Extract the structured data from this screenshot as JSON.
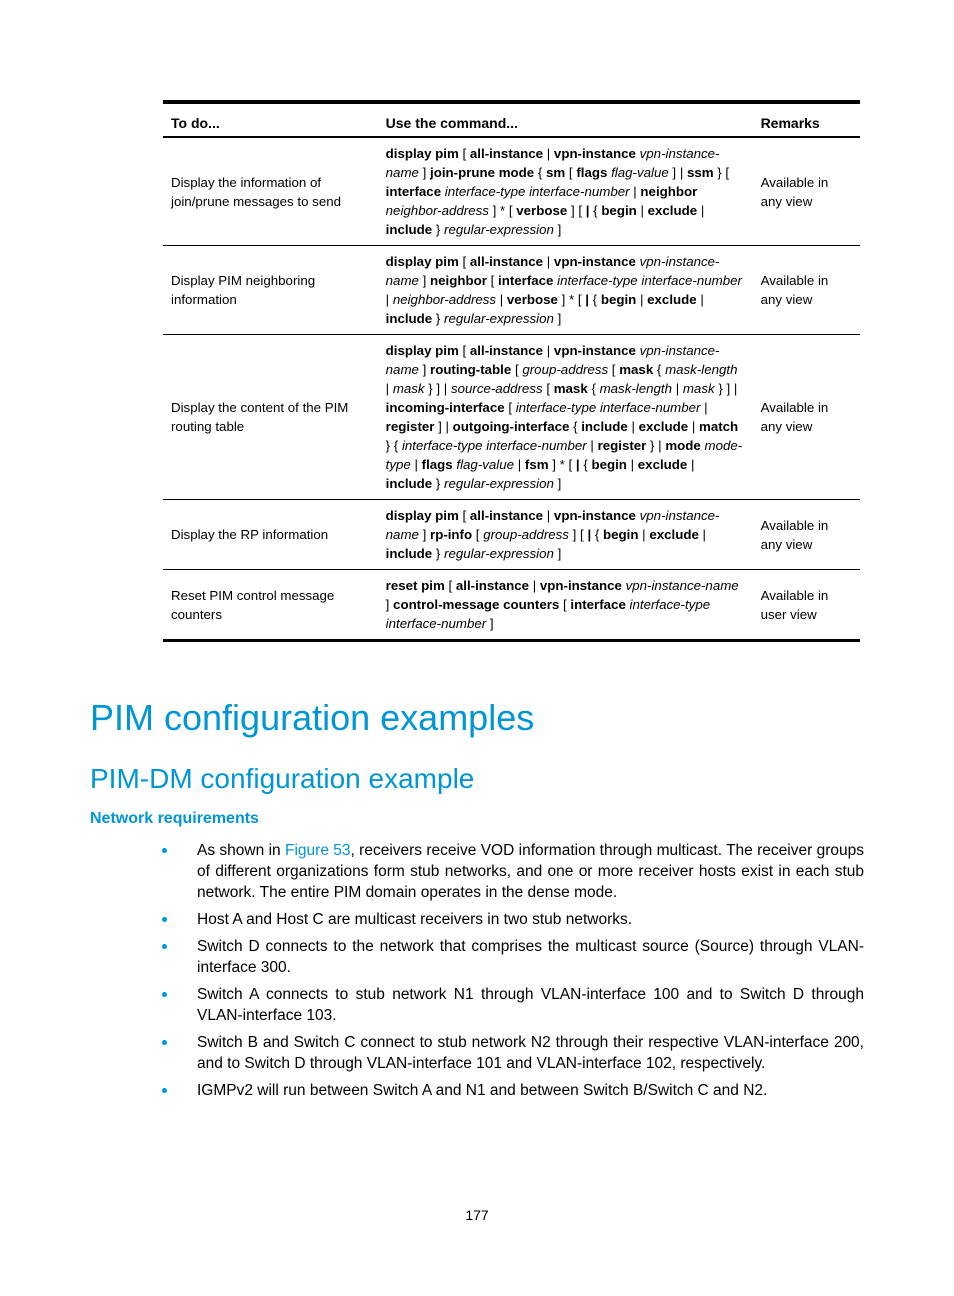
{
  "table": {
    "headers": [
      "To do...",
      "Use the command...",
      "Remarks"
    ],
    "rows": [
      {
        "todo": "Display the information of join/prune messages to send",
        "command_segments": [
          {
            "t": "display pim",
            "s": "b"
          },
          {
            "t": " [ ",
            "s": "n"
          },
          {
            "t": "all-instance",
            "s": "b"
          },
          {
            "t": " | ",
            "s": "n"
          },
          {
            "t": "vpn-instance",
            "s": "b"
          },
          {
            "t": " ",
            "s": "n"
          },
          {
            "t": "vpn-instance-name",
            "s": "i"
          },
          {
            "t": " ] ",
            "s": "n"
          },
          {
            "t": "join-prune mode",
            "s": "b"
          },
          {
            "t": " { ",
            "s": "n"
          },
          {
            "t": "sm",
            "s": "b"
          },
          {
            "t": " [ ",
            "s": "n"
          },
          {
            "t": "flags",
            "s": "b"
          },
          {
            "t": " ",
            "s": "n"
          },
          {
            "t": "flag-value",
            "s": "i"
          },
          {
            "t": " ] | ",
            "s": "n"
          },
          {
            "t": "ssm",
            "s": "b"
          },
          {
            "t": " } [ ",
            "s": "n"
          },
          {
            "t": "interface",
            "s": "b"
          },
          {
            "t": " ",
            "s": "n"
          },
          {
            "t": "interface-type",
            "s": "i"
          },
          {
            "t": " ",
            "s": "n"
          },
          {
            "t": "interface-number",
            "s": "i"
          },
          {
            "t": " | ",
            "s": "n"
          },
          {
            "t": "neighbor",
            "s": "b"
          },
          {
            "t": " ",
            "s": "n"
          },
          {
            "t": "neighbor-address",
            "s": "i"
          },
          {
            "t": " ] * [ ",
            "s": "n"
          },
          {
            "t": "verbose",
            "s": "b"
          },
          {
            "t": " ] [ ",
            "s": "n"
          },
          {
            "t": "|",
            "s": "b"
          },
          {
            "t": " { ",
            "s": "n"
          },
          {
            "t": "begin",
            "s": "b"
          },
          {
            "t": " | ",
            "s": "n"
          },
          {
            "t": "exclude",
            "s": "b"
          },
          {
            "t": " | ",
            "s": "n"
          },
          {
            "t": "include",
            "s": "b"
          },
          {
            "t": " } ",
            "s": "n"
          },
          {
            "t": "regular-expression",
            "s": "i"
          },
          {
            "t": " ]",
            "s": "n"
          }
        ],
        "remarks": "Available in any view"
      },
      {
        "todo": "Display PIM neighboring information",
        "command_segments": [
          {
            "t": "display pim",
            "s": "b"
          },
          {
            "t": " [ ",
            "s": "n"
          },
          {
            "t": "all-instance",
            "s": "b"
          },
          {
            "t": " | ",
            "s": "n"
          },
          {
            "t": "vpn-instance",
            "s": "b"
          },
          {
            "t": " ",
            "s": "n"
          },
          {
            "t": "vpn-instance-name",
            "s": "i"
          },
          {
            "t": " ] ",
            "s": "n"
          },
          {
            "t": "neighbor",
            "s": "b"
          },
          {
            "t": " [ ",
            "s": "n"
          },
          {
            "t": "interface",
            "s": "b"
          },
          {
            "t": " ",
            "s": "n"
          },
          {
            "t": "interface-type",
            "s": "i"
          },
          {
            "t": " ",
            "s": "n"
          },
          {
            "t": "interface-number",
            "s": "i"
          },
          {
            "t": " | ",
            "s": "n"
          },
          {
            "t": "neighbor-address",
            "s": "i"
          },
          {
            "t": " | ",
            "s": "n"
          },
          {
            "t": "verbose",
            "s": "b"
          },
          {
            "t": " ] * [ ",
            "s": "n"
          },
          {
            "t": "|",
            "s": "b"
          },
          {
            "t": " { ",
            "s": "n"
          },
          {
            "t": "begin",
            "s": "b"
          },
          {
            "t": " | ",
            "s": "n"
          },
          {
            "t": "exclude",
            "s": "b"
          },
          {
            "t": " | ",
            "s": "n"
          },
          {
            "t": "include",
            "s": "b"
          },
          {
            "t": " } ",
            "s": "n"
          },
          {
            "t": "regular-expression",
            "s": "i"
          },
          {
            "t": " ]",
            "s": "n"
          }
        ],
        "remarks": "Available in any view"
      },
      {
        "todo": "Display the content of the PIM routing table",
        "command_segments": [
          {
            "t": "display pim",
            "s": "b"
          },
          {
            "t": " [ ",
            "s": "n"
          },
          {
            "t": "all-instance",
            "s": "b"
          },
          {
            "t": " | ",
            "s": "n"
          },
          {
            "t": "vpn-instance",
            "s": "b"
          },
          {
            "t": " ",
            "s": "n"
          },
          {
            "t": "vpn-instance-name",
            "s": "i"
          },
          {
            "t": " ] ",
            "s": "n"
          },
          {
            "t": "routing-table",
            "s": "b"
          },
          {
            "t": " [ ",
            "s": "n"
          },
          {
            "t": "group-address",
            "s": "i"
          },
          {
            "t": " [ ",
            "s": "n"
          },
          {
            "t": "mask",
            "s": "b"
          },
          {
            "t": " ",
            "s": "n"
          },
          {
            "t": "{ ",
            "s": "n"
          },
          {
            "t": "mask-length",
            "s": "i"
          },
          {
            "t": " | ",
            "s": "n"
          },
          {
            "t": "mask",
            "s": "i"
          },
          {
            "t": " } ] | ",
            "s": "n"
          },
          {
            "t": "source-address",
            "s": "i"
          },
          {
            "t": " [ ",
            "s": "n"
          },
          {
            "t": "mask",
            "s": "b"
          },
          {
            "t": " ",
            "s": "n"
          },
          {
            "t": "{ ",
            "s": "n"
          },
          {
            "t": "mask-length",
            "s": "i"
          },
          {
            "t": " | ",
            "s": "n"
          },
          {
            "t": "mask",
            "s": "i"
          },
          {
            "t": " } ] | ",
            "s": "n"
          },
          {
            "t": "incoming-interface",
            "s": "b"
          },
          {
            "t": " ",
            "s": "n"
          },
          {
            "t": "[ ",
            "s": "n"
          },
          {
            "t": "interface-type interface-number",
            "s": "i"
          },
          {
            "t": " | ",
            "s": "n"
          },
          {
            "t": "register",
            "s": "b"
          },
          {
            "t": " ] | ",
            "s": "n"
          },
          {
            "t": "outgoing-interface",
            "s": "b"
          },
          {
            "t": " { ",
            "s": "n"
          },
          {
            "t": "include",
            "s": "b"
          },
          {
            "t": " | ",
            "s": "n"
          },
          {
            "t": "exclude",
            "s": "b"
          },
          {
            "t": " | ",
            "s": "n"
          },
          {
            "t": "match",
            "s": "b"
          },
          {
            "t": " } ",
            "s": "n"
          },
          {
            "t": "{ ",
            "s": "n"
          },
          {
            "t": "interface-type interface-number",
            "s": "i"
          },
          {
            "t": " | ",
            "s": "n"
          },
          {
            "t": "register",
            "s": "b"
          },
          {
            "t": " } | ",
            "s": "n"
          },
          {
            "t": "mode",
            "s": "b"
          },
          {
            "t": " ",
            "s": "n"
          },
          {
            "t": "mode-type",
            "s": "i"
          },
          {
            "t": " | ",
            "s": "n"
          },
          {
            "t": "flags",
            "s": "b"
          },
          {
            "t": " ",
            "s": "n"
          },
          {
            "t": "flag-value",
            "s": "i"
          },
          {
            "t": " | ",
            "s": "n"
          },
          {
            "t": "fsm",
            "s": "b"
          },
          {
            "t": " ] * [ ",
            "s": "n"
          },
          {
            "t": "|",
            "s": "b"
          },
          {
            "t": " { ",
            "s": "n"
          },
          {
            "t": "begin",
            "s": "b"
          },
          {
            "t": " | ",
            "s": "n"
          },
          {
            "t": "exclude",
            "s": "b"
          },
          {
            "t": " | ",
            "s": "n"
          },
          {
            "t": "include",
            "s": "b"
          },
          {
            "t": " } ",
            "s": "n"
          },
          {
            "t": "regular-expression",
            "s": "i"
          },
          {
            "t": " ]",
            "s": "n"
          }
        ],
        "remarks": "Available in any view"
      },
      {
        "todo": "Display the RP information",
        "command_segments": [
          {
            "t": "display pim",
            "s": "b"
          },
          {
            "t": " [ ",
            "s": "n"
          },
          {
            "t": "all-instance",
            "s": "b"
          },
          {
            "t": " | ",
            "s": "n"
          },
          {
            "t": "vpn-instance",
            "s": "b"
          },
          {
            "t": " ",
            "s": "n"
          },
          {
            "t": "vpn-instance-name",
            "s": "i"
          },
          {
            "t": " ] ",
            "s": "n"
          },
          {
            "t": "rp-info",
            "s": "b"
          },
          {
            "t": " [ ",
            "s": "n"
          },
          {
            "t": "group-address",
            "s": "i"
          },
          {
            "t": " ] [ ",
            "s": "n"
          },
          {
            "t": "|",
            "s": "b"
          },
          {
            "t": " { ",
            "s": "n"
          },
          {
            "t": "begin",
            "s": "b"
          },
          {
            "t": " | ",
            "s": "n"
          },
          {
            "t": "exclude",
            "s": "b"
          },
          {
            "t": " | ",
            "s": "n"
          },
          {
            "t": "include",
            "s": "b"
          },
          {
            "t": " } ",
            "s": "n"
          },
          {
            "t": "regular-expression",
            "s": "i"
          },
          {
            "t": " ]",
            "s": "n"
          }
        ],
        "remarks": "Available in any view"
      },
      {
        "todo": "Reset PIM control message counters",
        "command_segments": [
          {
            "t": "reset pim",
            "s": "b"
          },
          {
            "t": " [ ",
            "s": "n"
          },
          {
            "t": "all-instance",
            "s": "b"
          },
          {
            "t": " | ",
            "s": "n"
          },
          {
            "t": "vpn-instance",
            "s": "b"
          },
          {
            "t": " ",
            "s": "n"
          },
          {
            "t": "vpn-instance-name",
            "s": "i"
          },
          {
            "t": " ] ",
            "s": "n"
          },
          {
            "t": "control-message counters",
            "s": "b"
          },
          {
            "t": " [ ",
            "s": "n"
          },
          {
            "t": "interface",
            "s": "b"
          },
          {
            "t": " ",
            "s": "n"
          },
          {
            "t": "interface-type",
            "s": "i"
          },
          {
            "t": " ",
            "s": "n"
          },
          {
            "t": "interface-number",
            "s": "i"
          },
          {
            "t": " ]",
            "s": "n"
          }
        ],
        "remarks": "Available in user view"
      }
    ]
  },
  "headings": {
    "h1": "PIM configuration examples",
    "h2": "PIM-DM configuration example",
    "h3": "Network requirements"
  },
  "bullets": [
    {
      "pre": "As shown in ",
      "link": "Figure 53",
      "post": ", receivers receive VOD information through multicast. The receiver groups of different organizations form stub networks, and one or more receiver hosts exist in each stub network. The entire PIM domain operates in the dense mode."
    },
    {
      "pre": "Host A and Host C are multicast receivers in two stub networks.",
      "link": "",
      "post": ""
    },
    {
      "pre": "Switch D connects to the network that comprises the multicast source (Source) through VLAN-interface 300.",
      "link": "",
      "post": ""
    },
    {
      "pre": "Switch A connects to stub network N1 through VLAN-interface 100 and to Switch D through VLAN-interface 103.",
      "link": "",
      "post": ""
    },
    {
      "pre": "Switch B and Switch C connect to stub network N2 through their respective VLAN-interface 200, and to Switch D through VLAN-interface 101 and VLAN-interface 102, respectively.",
      "link": "",
      "post": ""
    },
    {
      "pre": "IGMPv2 will run between Switch A and N1 and between Switch B/Switch C and N2.",
      "link": "",
      "post": ""
    }
  ],
  "page_number": "177",
  "colors": {
    "accent": "#0096d6",
    "text": "#000000"
  }
}
